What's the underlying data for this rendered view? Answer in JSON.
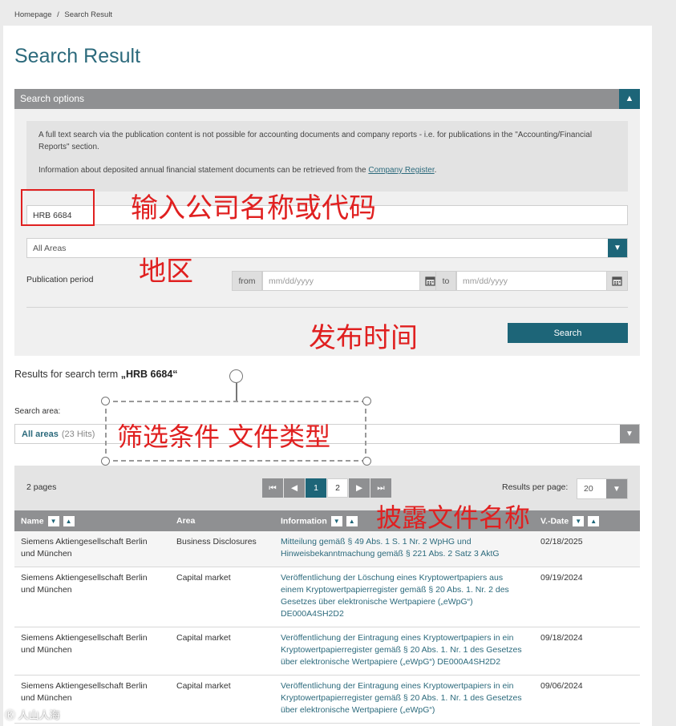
{
  "breadcrumb": {
    "home": "Homepage",
    "sep": "/",
    "current": "Search Result"
  },
  "page_title": "Search Result",
  "search_options": {
    "header": "Search options",
    "toggle_icon": "chevron-up-icon",
    "info_line1": "A full text search via the publication content is not possible for accounting documents and company reports - i.e. for publications in the \"Accounting/Financial Reports\" section.",
    "info_line2_prefix": "Information about deposited annual financial statement documents can be retrieved from the ",
    "info_link": "Company Register",
    "info_line2_suffix": ".",
    "search_value": "HRB 6684",
    "area_value": "All Areas",
    "period_label": "Publication period",
    "from_label": "from",
    "from_placeholder": "mm/dd/yyyy",
    "to_label": "to",
    "to_placeholder": "mm/dd/yyyy",
    "search_button": "Search"
  },
  "annotations": {
    "enter_company": "输入公司名称或代码",
    "region": "地区",
    "publish_time": "发布时间",
    "filter": "筛选条件 文件类型",
    "disclosure_name": "披露文件名称"
  },
  "results": {
    "prefix": "Results for search term ",
    "term": "„HRB 6684“",
    "search_area_label": "Search area:",
    "area_selected": "All areas",
    "area_hits": "(23 Hits)"
  },
  "pagination": {
    "pages_label": "2 pages",
    "pages": [
      "1",
      "2"
    ],
    "current_page": "1",
    "results_per_page_label": "Results per page:",
    "results_per_page": "20"
  },
  "table": {
    "columns": [
      "Name",
      "Area",
      "Information",
      "V.-Date"
    ],
    "rows": [
      {
        "name": "Siemens Aktiengesellschaft Berlin und München",
        "area": "Business Disclosures",
        "info": "Mitteilung gemäß § 49 Abs. 1 S. 1 Nr. 2 WpHG und Hinweisbekanntmachung gemäß § 221 Abs. 2 Satz 3 AktG",
        "date": "02/18/2025"
      },
      {
        "name": "Siemens Aktiengesellschaft Berlin und München",
        "area": "Capital market",
        "info": "Veröffentlichung der Löschung eines Kryptowertpapiers aus einem Kryptowertpapierregister gemäß § 20 Abs. 1. Nr. 2 des Gesetzes über elektronische Wertpapiere („eWpG“) DE000A4SH2D2",
        "date": "09/19/2024"
      },
      {
        "name": "Siemens Aktiengesellschaft Berlin und München",
        "area": "Capital market",
        "info": "Veröffentlichung der Eintragung eines Kryptowertpapiers in ein Kryptowertpapierregister gemäß § 20 Abs. 1. Nr. 1 des Gesetzes über elektronische Wertpapiere („eWpG“) DE000A4SH2D2",
        "date": "09/18/2024"
      },
      {
        "name": "Siemens Aktiengesellschaft Berlin und München",
        "area": "Capital market",
        "info": "Veröffentlichung der Eintragung eines Kryptowertpapiers in ein Kryptowertpapierregister gemäß § 20 Abs. 1. Nr. 1 des Gesetzes über elektronische Wertpapiere („eWpG“)",
        "date": "09/06/2024"
      }
    ]
  },
  "watermark": "Ⓚ 人山人海"
}
